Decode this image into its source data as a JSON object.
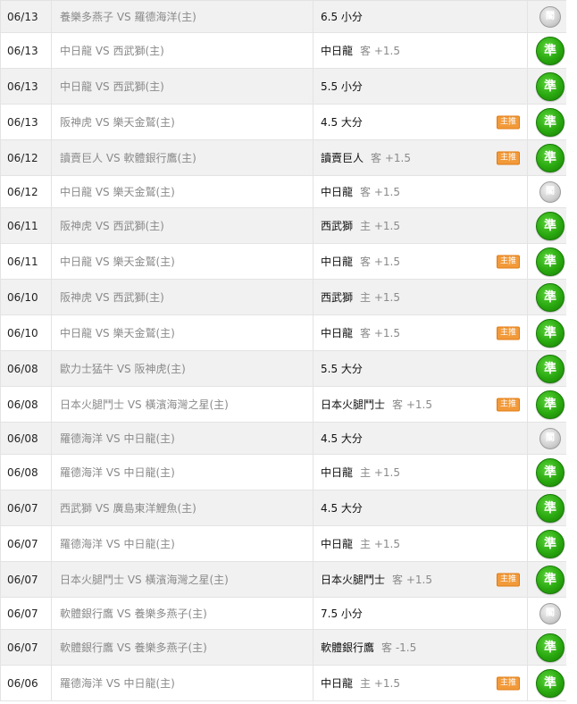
{
  "rows": [
    {
      "date": "06/13",
      "match": "養樂多燕子 VS 羅德海洋(主)",
      "pick": "6.5 小分",
      "extra": "",
      "badge": "",
      "result": "閣",
      "win": false
    },
    {
      "date": "06/13",
      "match": "中日龍 VS 西武獅(主)",
      "pick": "中日龍",
      "extra": "客 +1.5",
      "badge": "",
      "result": "準",
      "win": true
    },
    {
      "date": "06/13",
      "match": "中日龍 VS 西武獅(主)",
      "pick": "5.5 小分",
      "extra": "",
      "badge": "",
      "result": "準",
      "win": true
    },
    {
      "date": "06/13",
      "match": "阪神虎 VS 樂天金鷲(主)",
      "pick": "4.5 大分",
      "extra": "",
      "badge": "主推",
      "result": "準",
      "win": true
    },
    {
      "date": "06/12",
      "match": "讀賣巨人 VS 軟體銀行鷹(主)",
      "pick": "讀賣巨人",
      "extra": "客 +1.5",
      "badge": "主推",
      "result": "準",
      "win": true
    },
    {
      "date": "06/12",
      "match": "中日龍 VS 樂天金鷲(主)",
      "pick": "中日龍",
      "extra": "客 +1.5",
      "badge": "",
      "result": "閣",
      "win": false
    },
    {
      "date": "06/11",
      "match": "阪神虎 VS 西武獅(主)",
      "pick": "西武獅",
      "extra": "主 +1.5",
      "badge": "",
      "result": "準",
      "win": true
    },
    {
      "date": "06/11",
      "match": "中日龍 VS 樂天金鷲(主)",
      "pick": "中日龍",
      "extra": "客 +1.5",
      "badge": "主推",
      "result": "準",
      "win": true
    },
    {
      "date": "06/10",
      "match": "阪神虎 VS 西武獅(主)",
      "pick": "西武獅",
      "extra": "主 +1.5",
      "badge": "",
      "result": "準",
      "win": true
    },
    {
      "date": "06/10",
      "match": "中日龍 VS 樂天金鷲(主)",
      "pick": "中日龍",
      "extra": "客 +1.5",
      "badge": "主推",
      "result": "準",
      "win": true
    },
    {
      "date": "06/08",
      "match": "歐力士猛牛 VS 阪神虎(主)",
      "pick": "5.5 大分",
      "extra": "",
      "badge": "",
      "result": "準",
      "win": true
    },
    {
      "date": "06/08",
      "match": "日本火腿鬥士 VS 橫濱海灣之星(主)",
      "pick": "日本火腿鬥士",
      "extra": "客 +1.5",
      "badge": "主推",
      "result": "準",
      "win": true
    },
    {
      "date": "06/08",
      "match": "羅德海洋 VS 中日龍(主)",
      "pick": "4.5 大分",
      "extra": "",
      "badge": "",
      "result": "閣",
      "win": false
    },
    {
      "date": "06/08",
      "match": "羅德海洋 VS 中日龍(主)",
      "pick": "中日龍",
      "extra": "主 +1.5",
      "badge": "",
      "result": "準",
      "win": true
    },
    {
      "date": "06/07",
      "match": "西武獅 VS 廣島東洋鯉魚(主)",
      "pick": "4.5 大分",
      "extra": "",
      "badge": "",
      "result": "準",
      "win": true
    },
    {
      "date": "06/07",
      "match": "羅德海洋 VS 中日龍(主)",
      "pick": "中日龍",
      "extra": "主 +1.5",
      "badge": "",
      "result": "準",
      "win": true
    },
    {
      "date": "06/07",
      "match": "日本火腿鬥士 VS 橫濱海灣之星(主)",
      "pick": "日本火腿鬥士",
      "extra": "客 +1.5",
      "badge": "主推",
      "result": "準",
      "win": true
    },
    {
      "date": "06/07",
      "match": "軟體銀行鷹 VS 養樂多燕子(主)",
      "pick": "7.5 小分",
      "extra": "",
      "badge": "",
      "result": "閣",
      "win": false
    },
    {
      "date": "06/07",
      "match": "軟體銀行鷹 VS 養樂多燕子(主)",
      "pick": "軟體銀行鷹",
      "extra": "客 -1.5",
      "badge": "",
      "result": "準",
      "win": true
    },
    {
      "date": "06/06",
      "match": "羅德海洋 VS 中日龍(主)",
      "pick": "中日龍",
      "extra": "主 +1.5",
      "badge": "主推",
      "result": "準",
      "win": true
    }
  ],
  "colors": {
    "win": "#29a80f",
    "push": "#bdbdbd",
    "badge": "#f29a3a",
    "row_alt": "#f1f1f1"
  }
}
